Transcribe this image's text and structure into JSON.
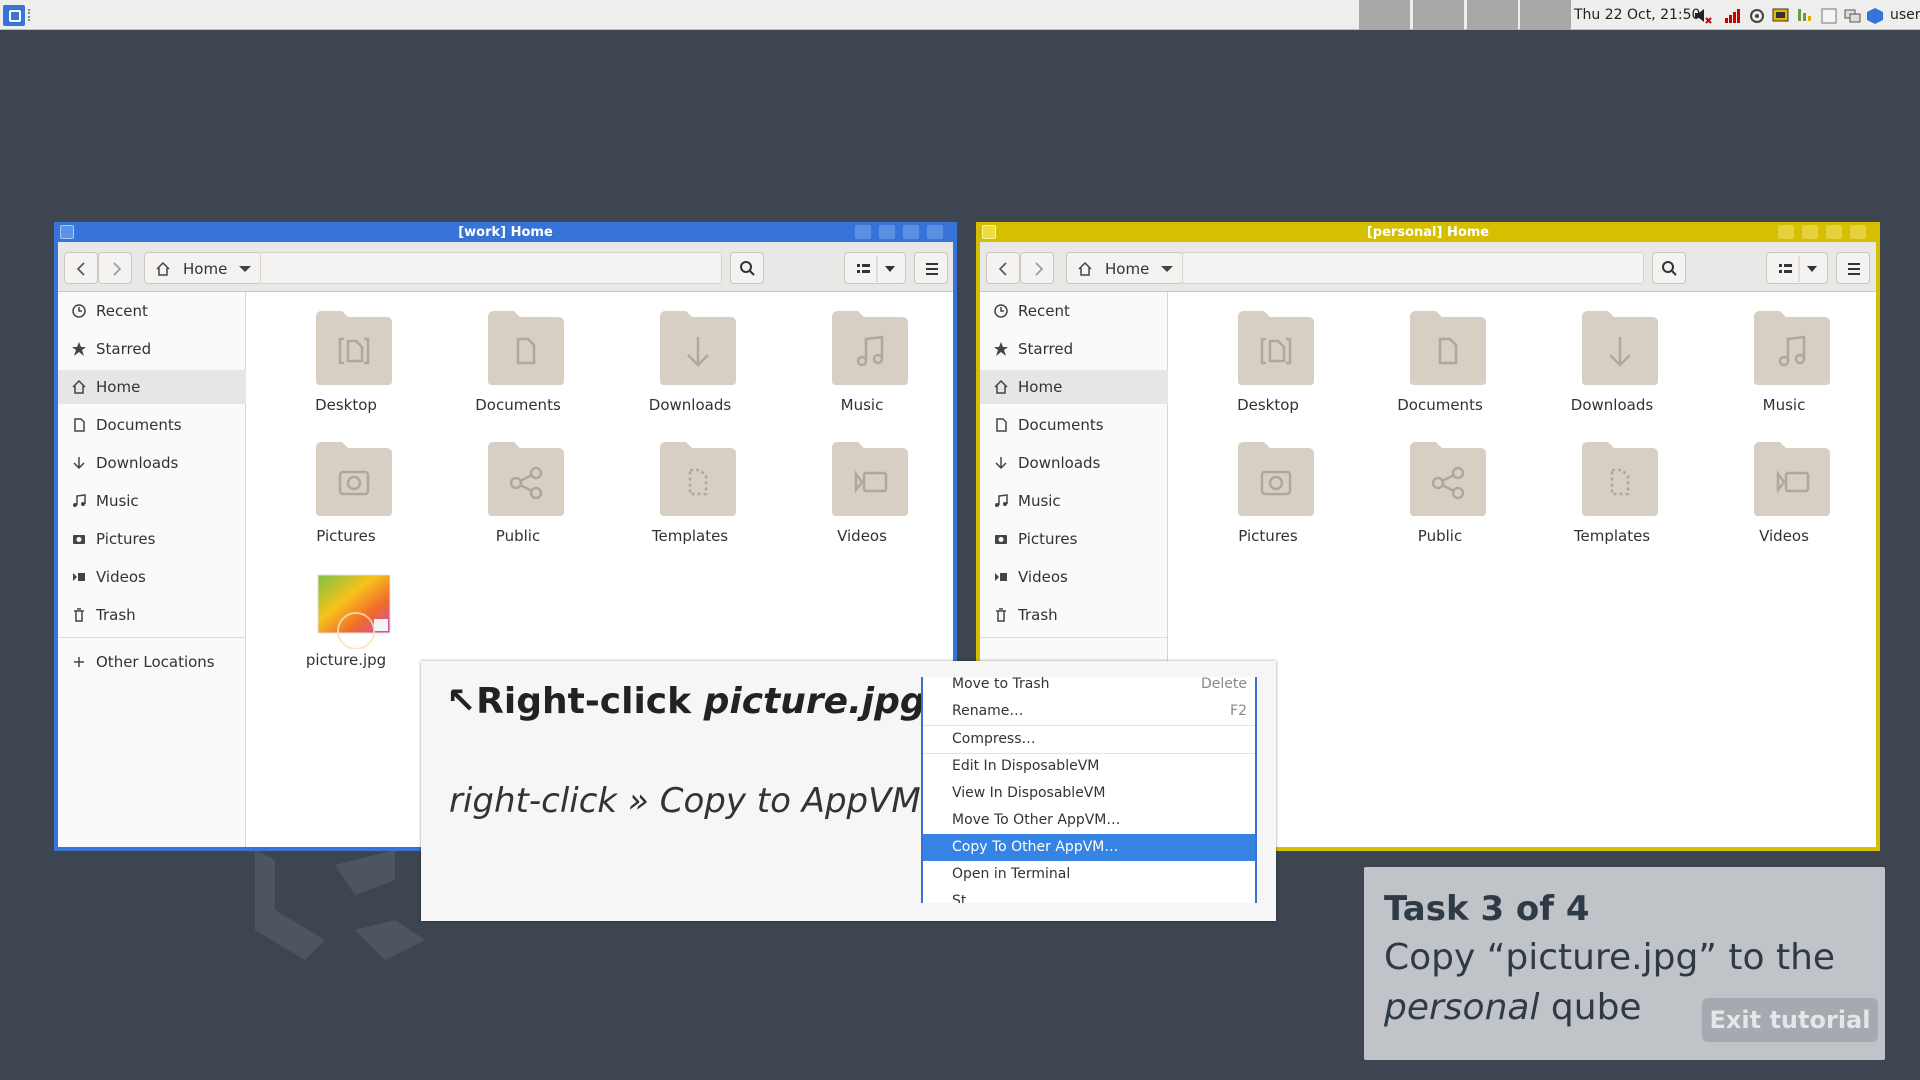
{
  "panel": {
    "clock": "Thu 22 Oct, 21:50",
    "user": "user",
    "tray_icons": [
      "volume-muted-icon",
      "network-signal-icon",
      "qubes-updates-icon",
      "devices-icon",
      "disk-icon",
      "clipboard-icon",
      "window-switcher-icon",
      "qubes-domains-icon"
    ]
  },
  "colors": {
    "work_frame": "#3874d8",
    "personal_frame": "#e0c800",
    "desktop_bg": "#3d4550",
    "highlight": "#3584e4"
  },
  "work_window": {
    "title": "[work] Home",
    "path": "Home",
    "sidebar": [
      "Recent",
      "Starred",
      "Home",
      "Documents",
      "Downloads",
      "Music",
      "Pictures",
      "Videos",
      "Trash",
      "Other Locations"
    ],
    "active_sidebar": "Home",
    "items": [
      "Desktop",
      "Documents",
      "Downloads",
      "Music",
      "Pictures",
      "Public",
      "Templates",
      "Videos",
      "picture.jpg"
    ]
  },
  "personal_window": {
    "title": "[personal] Home",
    "path": "Home",
    "sidebar": [
      "Recent",
      "Starred",
      "Home",
      "Documents",
      "Downloads",
      "Music",
      "Pictures",
      "Videos",
      "Trash"
    ],
    "active_sidebar": "Home",
    "items": [
      "Desktop",
      "Documents",
      "Downloads",
      "Music",
      "Pictures",
      "Public",
      "Templates",
      "Videos"
    ]
  },
  "tutorial": {
    "heading_prefix": "↖Right-click ",
    "heading_target": "picture.jpg",
    "hint": "right-click » Copy to AppVM",
    "context_menu": [
      {
        "label": "Move to Trash",
        "key": "Delete"
      },
      {
        "label": "Rename…",
        "key": "F2"
      },
      {
        "label": "Compress…",
        "key": ""
      },
      {
        "label": "Edit In DisposableVM",
        "key": ""
      },
      {
        "label": "View In DisposableVM",
        "key": ""
      },
      {
        "label": "Move To Other AppVM…",
        "key": ""
      },
      {
        "label": "Copy To Other AppVM…",
        "key": ""
      },
      {
        "label": "Open in Terminal",
        "key": ""
      },
      {
        "label": "St…",
        "key": ""
      }
    ],
    "selected_item": "Copy To Other AppVM…"
  },
  "task": {
    "title": "Task 3 of 4",
    "line1": "Copy “picture.jpg” to the",
    "line2_em": "personal",
    "line2_rest": " qube",
    "exit_label": "Exit tutorial"
  }
}
